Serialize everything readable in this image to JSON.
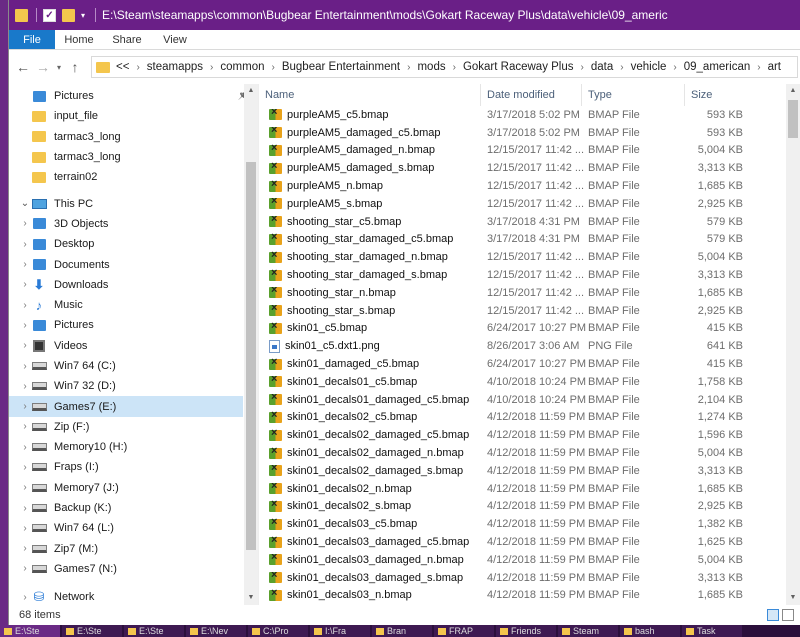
{
  "window": {
    "title": "E:\\Steam\\steamapps\\common\\Bugbear Entertainment\\mods\\Gokart Raceway Plus\\data\\vehicle\\09_americ"
  },
  "ribbon": {
    "tabs": [
      "File",
      "Home",
      "Share",
      "View"
    ]
  },
  "address": {
    "overflow": "<<",
    "crumbs": [
      "steamapps",
      "common",
      "Bugbear Entertainment",
      "mods",
      "Gokart Raceway Plus",
      "data",
      "vehicle",
      "09_american",
      "art"
    ]
  },
  "nav": {
    "items": [
      {
        "label": "Pictures",
        "icon": "pictures-icon",
        "chevron": "",
        "pinned": true
      },
      {
        "label": "input_file",
        "icon": "folder-icon",
        "chevron": ""
      },
      {
        "label": "tarmac3_long",
        "icon": "folder-icon",
        "chevron": ""
      },
      {
        "label": "tarmac3_long",
        "icon": "folder-icon",
        "chevron": ""
      },
      {
        "label": "terrain02",
        "icon": "folder-icon",
        "chevron": ""
      },
      {
        "label": "This PC",
        "icon": "pc-icon",
        "chevron": "v",
        "indent": 0
      },
      {
        "label": "3D Objects",
        "icon": "3d-objects-icon",
        "chevron": ">"
      },
      {
        "label": "Desktop",
        "icon": "desktop-icon",
        "chevron": ">"
      },
      {
        "label": "Documents",
        "icon": "documents-icon",
        "chevron": ">"
      },
      {
        "label": "Downloads",
        "icon": "downloads-icon",
        "chevron": ">"
      },
      {
        "label": "Music",
        "icon": "music-icon",
        "chevron": ">"
      },
      {
        "label": "Pictures",
        "icon": "pictures-icon",
        "chevron": ">"
      },
      {
        "label": "Videos",
        "icon": "videos-icon",
        "chevron": ">"
      },
      {
        "label": "Win7 64 (C:)",
        "icon": "drive-icon",
        "chevron": ">"
      },
      {
        "label": "Win7 32 (D:)",
        "icon": "drive-icon",
        "chevron": ">"
      },
      {
        "label": "Games7 (E:)",
        "icon": "drive-icon",
        "chevron": ">",
        "selected": true
      },
      {
        "label": "Zip (F:)",
        "icon": "drive-icon",
        "chevron": ">"
      },
      {
        "label": "Memory10 (H:)",
        "icon": "drive-icon",
        "chevron": ">"
      },
      {
        "label": "Fraps (I:)",
        "icon": "drive-icon",
        "chevron": ">"
      },
      {
        "label": "Memory7 (J:)",
        "icon": "drive-icon",
        "chevron": ">"
      },
      {
        "label": "Backup (K:)",
        "icon": "drive-icon",
        "chevron": ">"
      },
      {
        "label": "Win7 64 (L:)",
        "icon": "drive-icon",
        "chevron": ">"
      },
      {
        "label": "Zip7 (M:)",
        "icon": "drive-icon",
        "chevron": ">"
      },
      {
        "label": "Games7 (N:)",
        "icon": "drive-icon",
        "chevron": ">"
      },
      {
        "label": "Network",
        "icon": "network-icon",
        "chevron": ">"
      }
    ]
  },
  "columns": {
    "name": "Name",
    "date": "Date modified",
    "type": "Type",
    "size": "Size"
  },
  "files": [
    {
      "name": "purpleAM5_c5.bmap",
      "date": "3/17/2018 5:02 PM",
      "type": "BMAP File",
      "size": "593 KB",
      "icon": "bmap"
    },
    {
      "name": "purpleAM5_damaged_c5.bmap",
      "date": "3/17/2018 5:02 PM",
      "type": "BMAP File",
      "size": "593 KB",
      "icon": "bmap"
    },
    {
      "name": "purpleAM5_damaged_n.bmap",
      "date": "12/15/2017 11:42 ...",
      "type": "BMAP File",
      "size": "5,004 KB",
      "icon": "bmap"
    },
    {
      "name": "purpleAM5_damaged_s.bmap",
      "date": "12/15/2017 11:42 ...",
      "type": "BMAP File",
      "size": "3,313 KB",
      "icon": "bmap"
    },
    {
      "name": "purpleAM5_n.bmap",
      "date": "12/15/2017 11:42 ...",
      "type": "BMAP File",
      "size": "1,685 KB",
      "icon": "bmap"
    },
    {
      "name": "purpleAM5_s.bmap",
      "date": "12/15/2017 11:42 ...",
      "type": "BMAP File",
      "size": "2,925 KB",
      "icon": "bmap"
    },
    {
      "name": "shooting_star_c5.bmap",
      "date": "3/17/2018 4:31 PM",
      "type": "BMAP File",
      "size": "579 KB",
      "icon": "bmap"
    },
    {
      "name": "shooting_star_damaged_c5.bmap",
      "date": "3/17/2018 4:31 PM",
      "type": "BMAP File",
      "size": "579 KB",
      "icon": "bmap"
    },
    {
      "name": "shooting_star_damaged_n.bmap",
      "date": "12/15/2017 11:42 ...",
      "type": "BMAP File",
      "size": "5,004 KB",
      "icon": "bmap"
    },
    {
      "name": "shooting_star_damaged_s.bmap",
      "date": "12/15/2017 11:42 ...",
      "type": "BMAP File",
      "size": "3,313 KB",
      "icon": "bmap"
    },
    {
      "name": "shooting_star_n.bmap",
      "date": "12/15/2017 11:42 ...",
      "type": "BMAP File",
      "size": "1,685 KB",
      "icon": "bmap"
    },
    {
      "name": "shooting_star_s.bmap",
      "date": "12/15/2017 11:42 ...",
      "type": "BMAP File",
      "size": "2,925 KB",
      "icon": "bmap"
    },
    {
      "name": "skin01_c5.bmap",
      "date": "6/24/2017 10:27 PM",
      "type": "BMAP File",
      "size": "415 KB",
      "icon": "bmap"
    },
    {
      "name": "skin01_c5.dxt1.png",
      "date": "8/26/2017 3:06 AM",
      "type": "PNG File",
      "size": "641 KB",
      "icon": "png"
    },
    {
      "name": "skin01_damaged_c5.bmap",
      "date": "6/24/2017 10:27 PM",
      "type": "BMAP File",
      "size": "415 KB",
      "icon": "bmap"
    },
    {
      "name": "skin01_decals01_c5.bmap",
      "date": "4/10/2018 10:24 PM",
      "type": "BMAP File",
      "size": "1,758 KB",
      "icon": "bmap"
    },
    {
      "name": "skin01_decals01_damaged_c5.bmap",
      "date": "4/10/2018 10:24 PM",
      "type": "BMAP File",
      "size": "2,104 KB",
      "icon": "bmap"
    },
    {
      "name": "skin01_decals02_c5.bmap",
      "date": "4/12/2018 11:59 PM",
      "type": "BMAP File",
      "size": "1,274 KB",
      "icon": "bmap"
    },
    {
      "name": "skin01_decals02_damaged_c5.bmap",
      "date": "4/12/2018 11:59 PM",
      "type": "BMAP File",
      "size": "1,596 KB",
      "icon": "bmap"
    },
    {
      "name": "skin01_decals02_damaged_n.bmap",
      "date": "4/12/2018 11:59 PM",
      "type": "BMAP File",
      "size": "5,004 KB",
      "icon": "bmap"
    },
    {
      "name": "skin01_decals02_damaged_s.bmap",
      "date": "4/12/2018 11:59 PM",
      "type": "BMAP File",
      "size": "3,313 KB",
      "icon": "bmap"
    },
    {
      "name": "skin01_decals02_n.bmap",
      "date": "4/12/2018 11:59 PM",
      "type": "BMAP File",
      "size": "1,685 KB",
      "icon": "bmap"
    },
    {
      "name": "skin01_decals02_s.bmap",
      "date": "4/12/2018 11:59 PM",
      "type": "BMAP File",
      "size": "2,925 KB",
      "icon": "bmap"
    },
    {
      "name": "skin01_decals03_c5.bmap",
      "date": "4/12/2018 11:59 PM",
      "type": "BMAP File",
      "size": "1,382 KB",
      "icon": "bmap"
    },
    {
      "name": "skin01_decals03_damaged_c5.bmap",
      "date": "4/12/2018 11:59 PM",
      "type": "BMAP File",
      "size": "1,625 KB",
      "icon": "bmap"
    },
    {
      "name": "skin01_decals03_damaged_n.bmap",
      "date": "4/12/2018 11:59 PM",
      "type": "BMAP File",
      "size": "5,004 KB",
      "icon": "bmap"
    },
    {
      "name": "skin01_decals03_damaged_s.bmap",
      "date": "4/12/2018 11:59 PM",
      "type": "BMAP File",
      "size": "3,313 KB",
      "icon": "bmap"
    },
    {
      "name": "skin01_decals03_n.bmap",
      "date": "4/12/2018 11:59 PM",
      "type": "BMAP File",
      "size": "1,685 KB",
      "icon": "bmap"
    }
  ],
  "status": {
    "count": "68 items"
  },
  "taskbar": {
    "items": [
      "E:\\Ste",
      "E:\\Ste",
      "E:\\Ste",
      "E:\\Nev",
      "C:\\Pro",
      "I:\\Fra",
      "Bran",
      "FRAP",
      "Friends",
      "Steam",
      "bash",
      "Task"
    ]
  },
  "colors": {
    "titlebar": "#6a1f87",
    "file_tab": "#1979ca",
    "selected": "#cce4f7"
  }
}
